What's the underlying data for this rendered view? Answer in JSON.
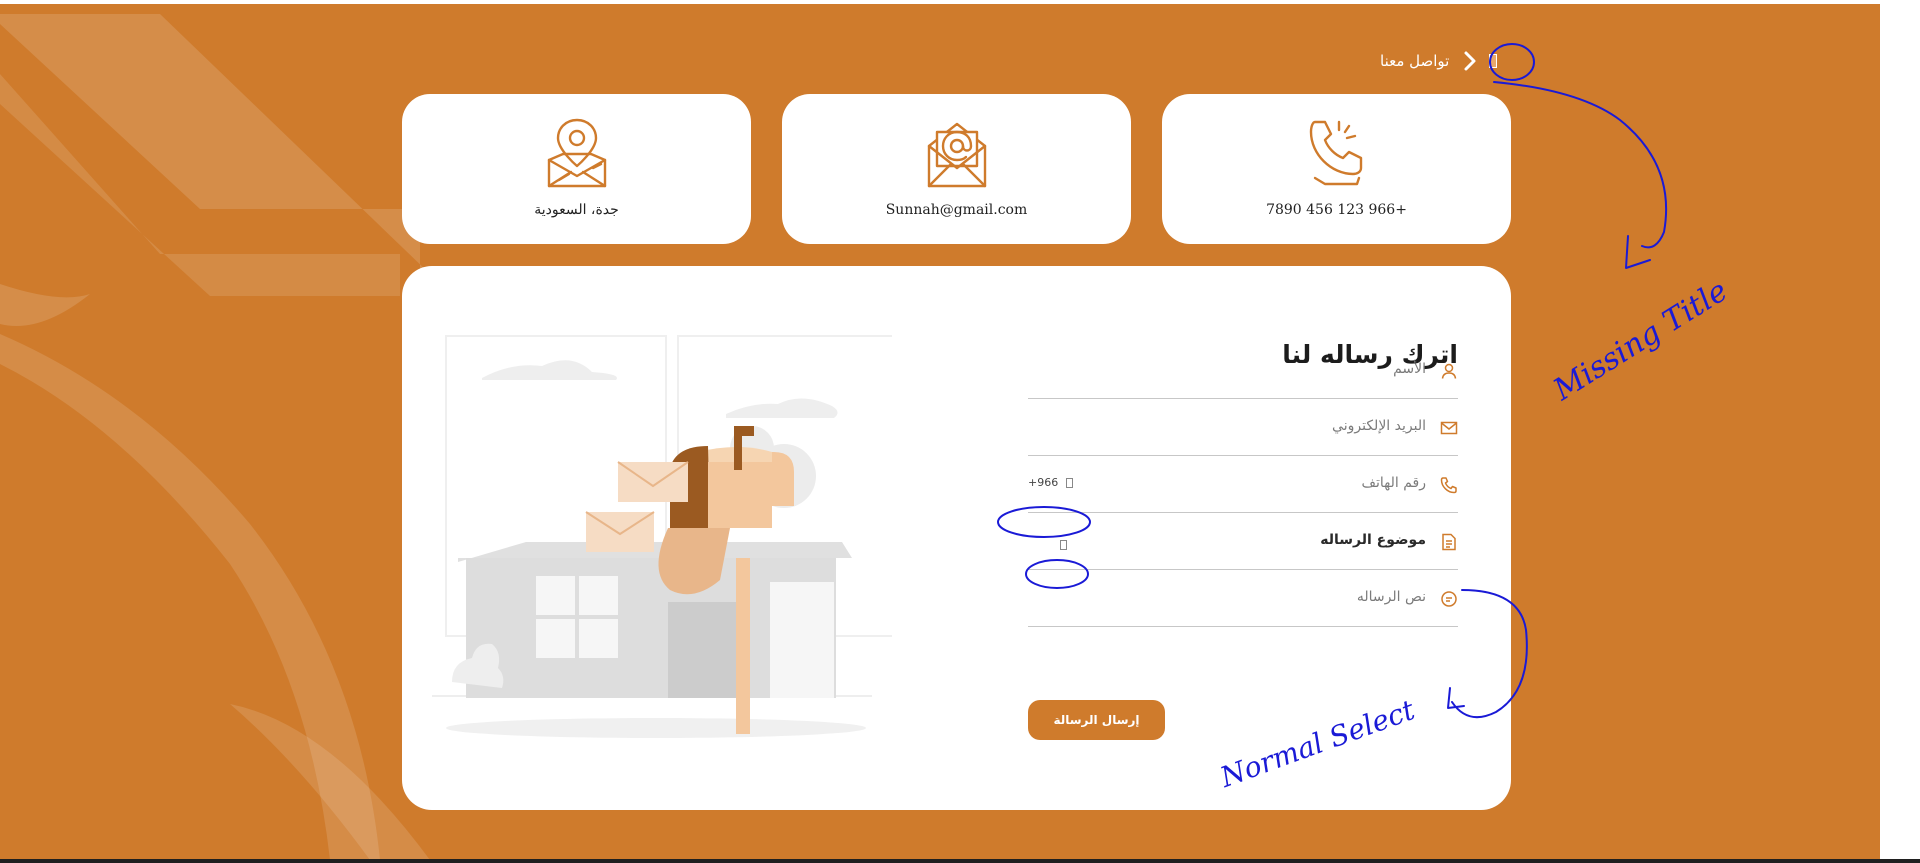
{
  "breadcrumb": {
    "label": "تواصل معنا"
  },
  "cards": {
    "phone": {
      "icon": "phone-icon",
      "text": "7890  456  123  966+"
    },
    "email": {
      "icon": "email-icon",
      "text": "Sunnah@gmail.com"
    },
    "location": {
      "icon": "location-pin-icon",
      "text": "جدة، السعودية"
    }
  },
  "form": {
    "title": "اترك رساله لنا",
    "fields": {
      "name": {
        "placeholder": "الأسم",
        "icon": "user-icon"
      },
      "email": {
        "placeholder": "البريد الإلكتروني",
        "icon": "envelope-icon"
      },
      "phone": {
        "placeholder": "رقم الهاتف",
        "icon": "phone-icon",
        "country_code": "+966"
      },
      "subject": {
        "placeholder": "موضوع الرساله",
        "icon": "document-icon"
      },
      "message": {
        "placeholder": "نص الرساله",
        "icon": "chat-icon"
      }
    },
    "submit_label": "إرسال الرسالة"
  },
  "annotations": {
    "missing_title": "Missing Title",
    "normal_select": "Normal Select"
  },
  "colors": {
    "brand_orange": "#cf7b2c",
    "card_white": "#ffffff",
    "annotation_blue": "#1a1ad6"
  }
}
